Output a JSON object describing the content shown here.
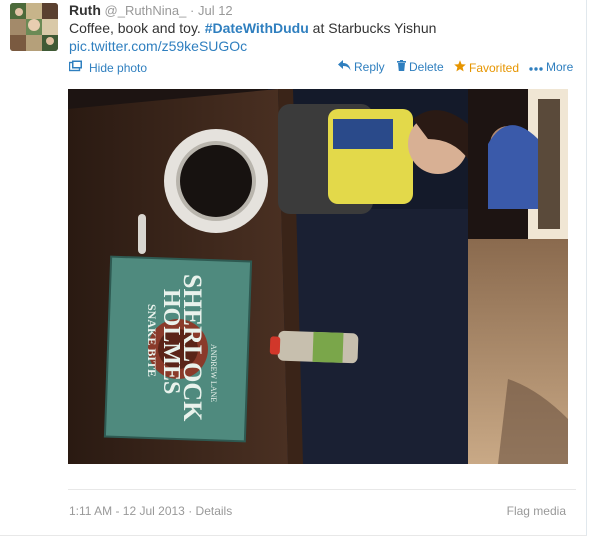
{
  "tweet": {
    "fullname": "Ruth",
    "username": "@_RuthNina_",
    "separator": "·",
    "time": "Jul 12",
    "text_before": "Coffee, book and toy. ",
    "hashtag": "#DateWithDudu",
    "text_after": " at Starbucks Yishun",
    "pic_link": "pic.twitter.com/z59keSUGOc"
  },
  "actions": {
    "hide_photo": "Hide photo",
    "reply": "Reply",
    "delete": "Delete",
    "favorited": "Favorited",
    "more": "More"
  },
  "photo": {
    "book_author": "ANDREW LANE",
    "book_title_1": "SHERLOCK",
    "book_title_2": "HOLMES",
    "book_title_3": "SNAKE BITE"
  },
  "footer": {
    "timestamp": "1:11 AM - 12 Jul 2013",
    "separator": "·",
    "details": "Details",
    "flag_media": "Flag media"
  },
  "colors": {
    "link": "#2f7fbf",
    "favorited": "#e69500",
    "muted": "#999999"
  }
}
